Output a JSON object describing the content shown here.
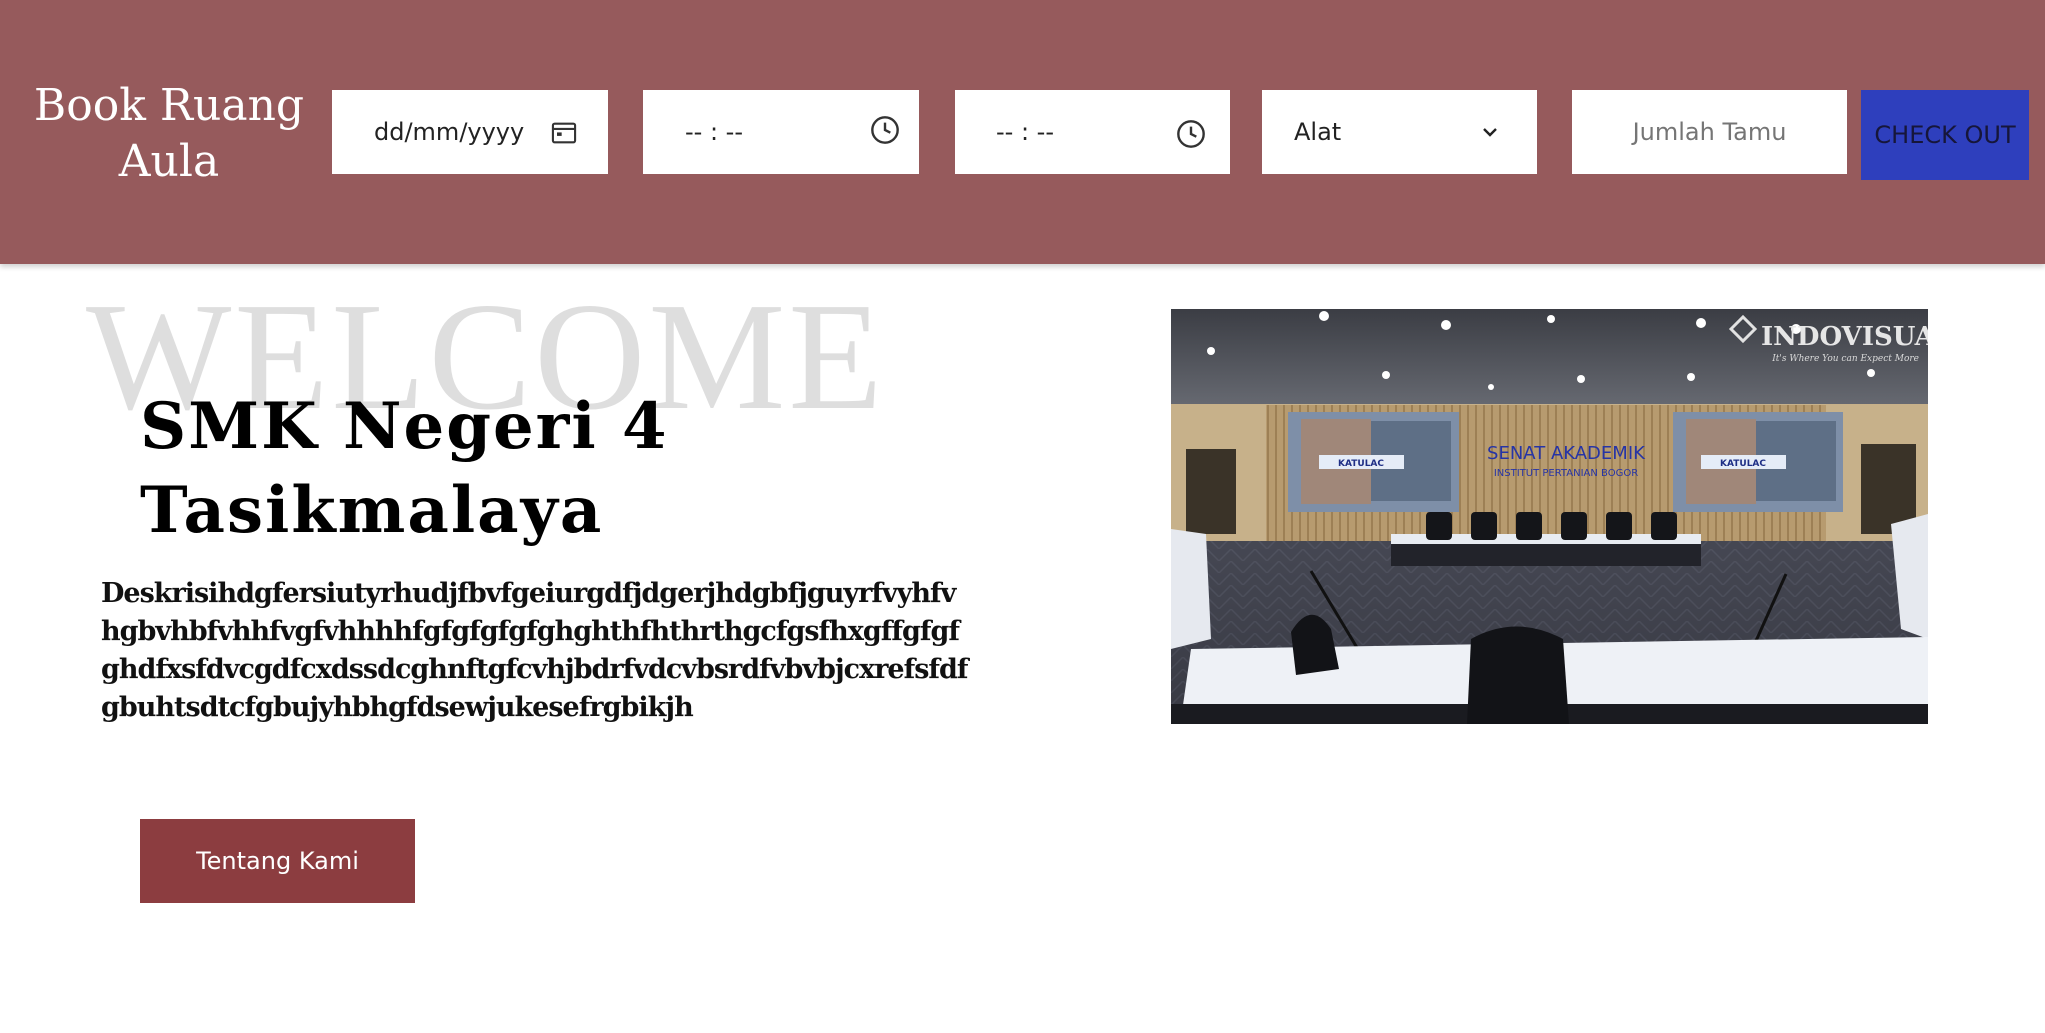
{
  "header": {
    "brand_title": "Book Ruang Aula",
    "date_field": {
      "placeholder": "dd/mm/yyyy",
      "icon": "calendar-icon"
    },
    "start_time_field": {
      "placeholder": "-- : --",
      "icon": "clock-icon"
    },
    "end_time_field": {
      "placeholder": "-- : --",
      "icon": "clock-icon"
    },
    "equipment_select": {
      "selected": "Alat",
      "icon": "chevron-down-icon"
    },
    "guests_field": {
      "placeholder": "Jumlah Tamu"
    },
    "checkout_label": "CHECK OUT"
  },
  "hero": {
    "watermark": "WELCOME",
    "school_name": "SMK Negeri 4 Tasikmalaya",
    "description": "Deskrisihdgfersiutyrhudjfbvfgeiurgdfjdgerjhdgbfjguyrfvyhfvhgbvhbfvhhfvgfvhhhhfgfgfgfgfghghthfhthrthgcfgsfhxgffgfgfghdfxsfdvcgdfcxdssdcghnftgfcvhjbdrfvdcvbsrdfvbvbjcxrefsfdfgbuhtsdtcfgbujyhbhgfdsewjukesefrgbikjh",
    "about_button": "Tentang Kami"
  },
  "photo": {
    "watermark_brand": "INDOVISUAL",
    "watermark_tagline": "It's Where You can Expect More",
    "wall_sign_title": "SENAT AKADEMIK",
    "wall_sign_subtitle": "INSTITUT PERTANIAN BOGOR",
    "screen_label": "KATULAC"
  },
  "colors": {
    "header_bg": "#965a5c",
    "checkout_bg": "#2e3fbd",
    "about_bg": "#8c3d40",
    "watermark": "#dedede"
  }
}
